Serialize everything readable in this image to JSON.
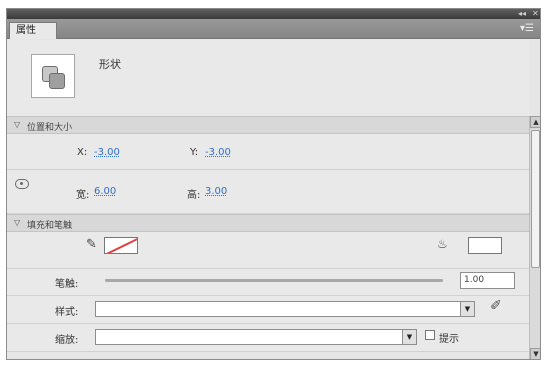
{
  "panel": {
    "tab_label": "属性",
    "menu_icon": "panel-menu-icon",
    "window_controls": [
      "◂◂",
      "✕"
    ],
    "instance_type": "形状"
  },
  "position_size": {
    "title": "位置和大小",
    "x_label": "X:",
    "x_value": "-3.00",
    "y_label": "Y:",
    "y_value": "-3.00",
    "width_label": "宽:",
    "width_value": "6.00",
    "height_label": "高:",
    "height_value": "3.00"
  },
  "fill_stroke": {
    "title": "填充和笔触",
    "stroke_color": "none",
    "fill_color": "#ffffff",
    "stroke_label": "笔触:",
    "stroke_value": "1.00",
    "style_label": "样式:",
    "style_value": "",
    "scale_label": "缩放:",
    "scale_value": "",
    "hint_label": "提示"
  },
  "colors": {
    "value_link": "#2f6fc7",
    "no_stroke_line": "#e04040"
  }
}
